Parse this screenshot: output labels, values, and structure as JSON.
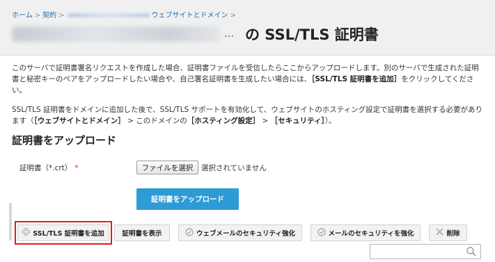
{
  "breadcrumb": {
    "home": "ホーム",
    "contracts": "契約",
    "websites": "ウェブサイトとドメイン"
  },
  "header": {
    "title_ellipsis": "…",
    "title": "の SSL/TLS 証明書"
  },
  "intro": {
    "p1_text": "このサーバで証明書署名リクエストを作成した場合、証明書ファイルを受信したらここからアップロードします。別のサーバで生成された証明書と秘密キーのペアをアップロードしたい場合や、自己署名証明書を生成したい場合には、",
    "p1_link": "［SSL/TLS 証明書を追加］",
    "p1_end": "をクリックしてください。",
    "p2_text": "SSL/TLS 証明書をドメインに追加した後で、SSL/TLS サポートを有効化して、ウェブサイトのホスティング設定で証明書を選択する必要があります（",
    "p2_b1": "［ウェブサイトとドメイン］",
    "p2_t2": " > このドメインの",
    "p2_b2": "［ホスティング設定］",
    "p2_t3": " > ",
    "p2_b3": "［セキュリティ］",
    "p2_end": "）。"
  },
  "upload_section": {
    "title": "証明書をアップロード",
    "field_label": "証明書（*.crt）",
    "required_mark": "*",
    "file_button": "ファイルを選択",
    "file_status": "選択されていません",
    "upload_button": "証明書をアップロード"
  },
  "toolbar": {
    "add": "SSL/TLS 証明書を追加",
    "show": "証明書を表示",
    "web_mail_security": "ウェブメールのセキュリティ強化",
    "mail_security": "メールのセキュリティを強化",
    "delete": "削除"
  },
  "search": {
    "placeholder": "",
    "value": ""
  },
  "colors": {
    "link": "#1f6aa5",
    "primary_button": "#2e9bd6",
    "highlight": "#e01a1a",
    "required": "#d13030"
  },
  "icons": {
    "add": "plus-icon",
    "web_mail": "shield-icon",
    "mail": "shield-icon",
    "delete": "x-icon",
    "search": "search-icon"
  }
}
